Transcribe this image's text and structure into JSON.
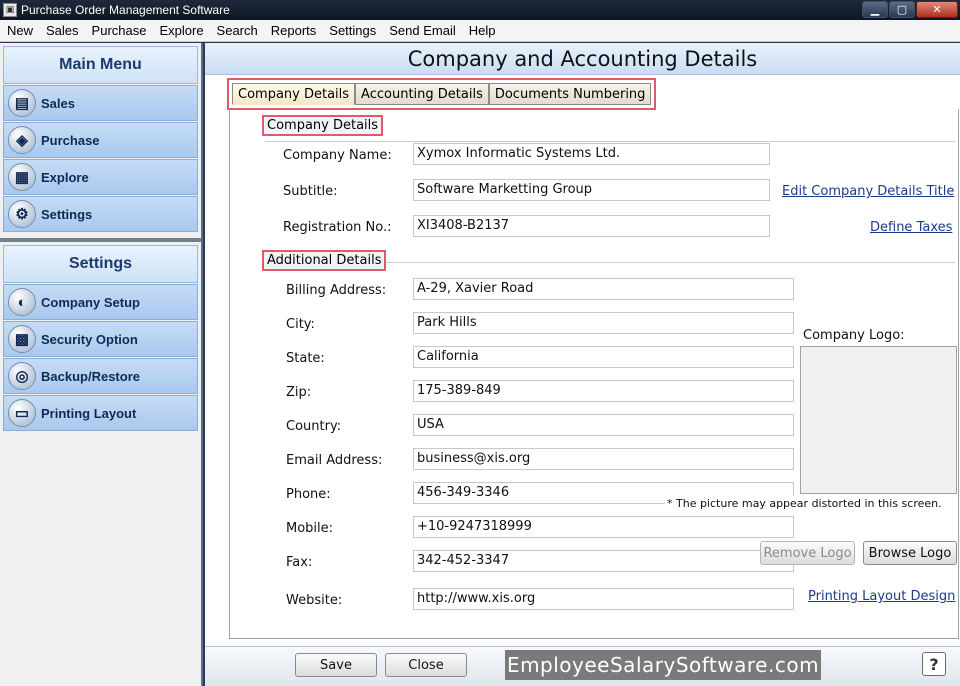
{
  "window": {
    "title": "Purchase Order Management Software"
  },
  "menu": [
    "New",
    "Sales",
    "Purchase",
    "Explore",
    "Search",
    "Reports",
    "Settings",
    "Send Email",
    "Help"
  ],
  "sidebar": {
    "main_menu_title": "Main Menu",
    "main_items": [
      "Sales",
      "Purchase",
      "Explore",
      "Settings"
    ],
    "settings_title": "Settings",
    "settings_items": [
      "Company Setup",
      "Security Option",
      "Backup/Restore",
      "Printing Layout"
    ]
  },
  "main": {
    "title": "Company and Accounting Details",
    "tabs": [
      "Company Details",
      "Accounting Details",
      "Documents Numbering"
    ],
    "company_section": "Company Details",
    "additional_section": "Additional Details",
    "company_fields": {
      "name_label": "Company Name:",
      "name_value": "Xymox Informatic Systems Ltd.",
      "subtitle_label": "Subtitle:",
      "subtitle_value": "Software Marketting Group",
      "reg_label": "Registration No.:",
      "reg_value": "XI3408-B2137"
    },
    "links": {
      "edit_title": "Edit Company Details Title",
      "define_taxes": "Define Taxes",
      "printing_layout": "Printing Layout Design"
    },
    "additional_fields": [
      {
        "label": "Billing Address:",
        "value": "A-29, Xavier Road"
      },
      {
        "label": "City:",
        "value": "Park Hills"
      },
      {
        "label": "State:",
        "value": "California"
      },
      {
        "label": "Zip:",
        "value": "175-389-849"
      },
      {
        "label": "Country:",
        "value": "USA"
      },
      {
        "label": "Email Address:",
        "value": "business@xis.org"
      },
      {
        "label": "Phone:",
        "value": "456-349-3346"
      },
      {
        "label": "Mobile:",
        "value": "+10-9247318999"
      },
      {
        "label": "Fax:",
        "value": "342-452-3347"
      },
      {
        "label": "Website:",
        "value": "http://www.xis.org"
      }
    ],
    "logo_label": "Company Logo:",
    "logo_note": "* The picture may appear distorted in this screen.",
    "remove_logo": "Remove Logo",
    "browse_logo": "Browse Logo",
    "save": "Save",
    "close": "Close"
  },
  "watermark": "EmployeeSalarySoftware.com",
  "help_icon": "?"
}
